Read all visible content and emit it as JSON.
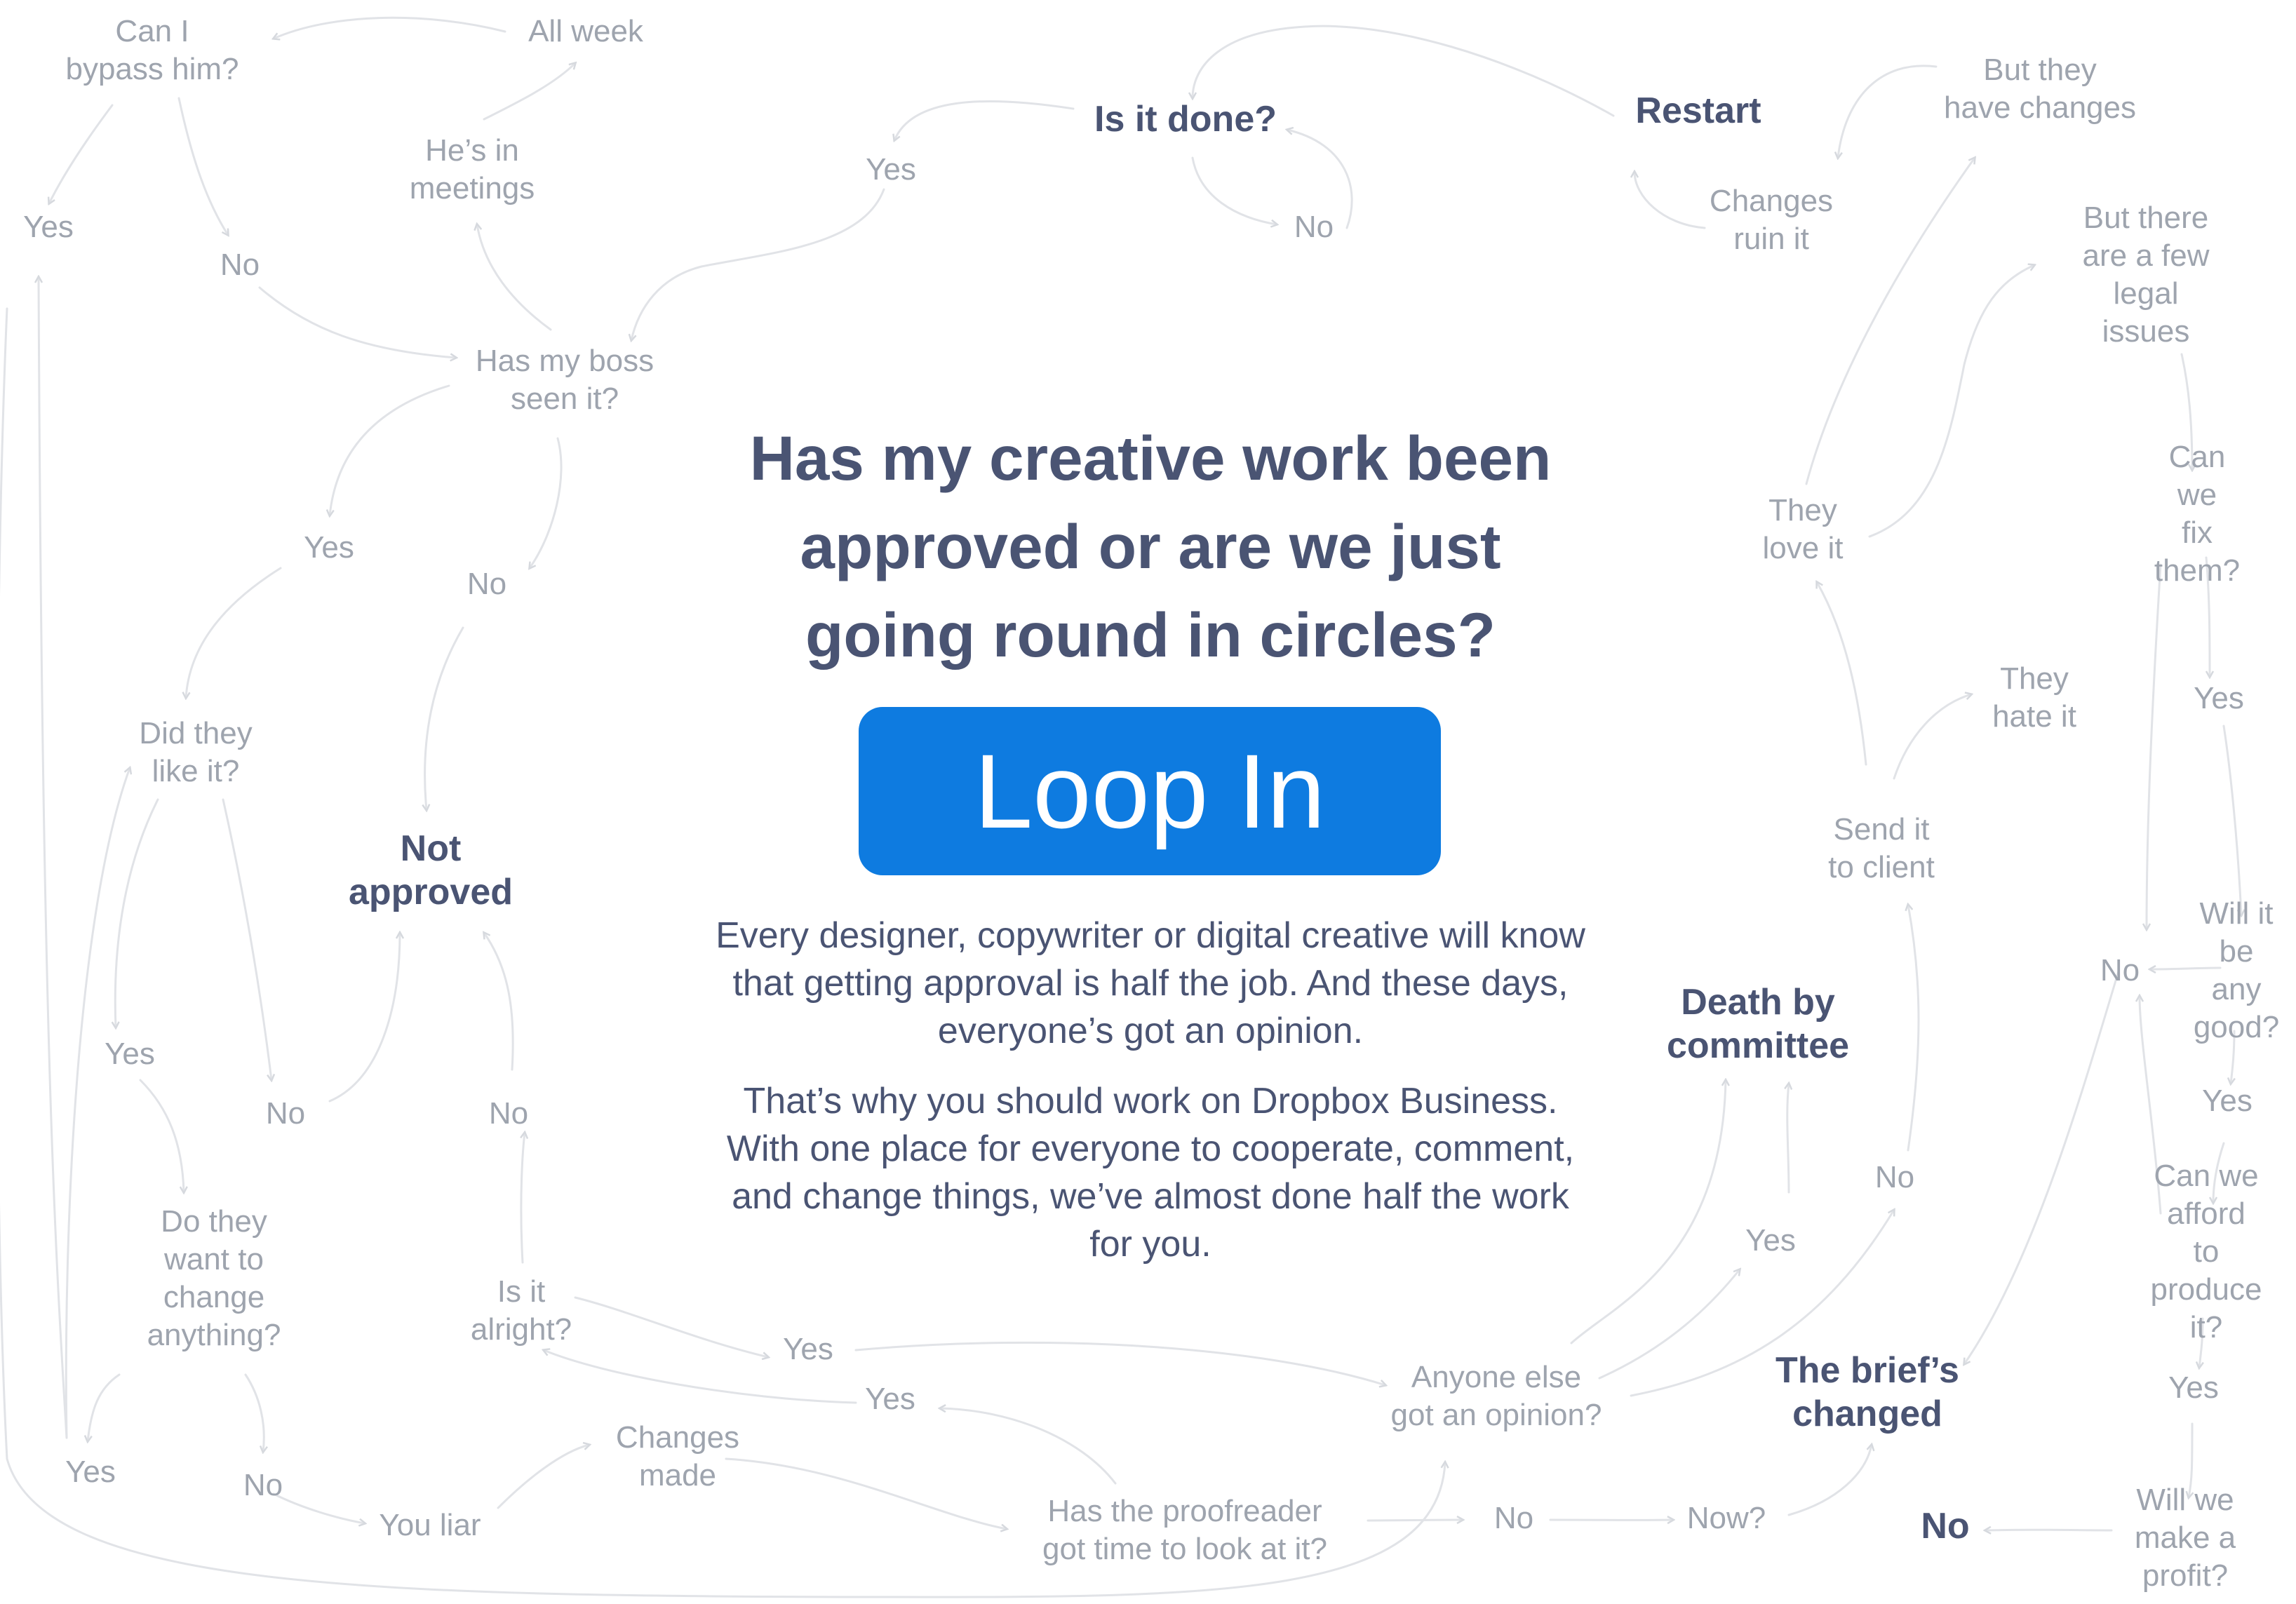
{
  "headline": "Has my creative work been approved or are we just going round in circles?",
  "cta_label": "Loop In",
  "body_paragraphs": [
    "Every designer, copywriter or digital creative will know that getting approval is half the job. And these days, everyone’s got an opinion.",
    "That’s why you should work on Dropbox Business. With one place for everyone to cooperate, comment, and change things, we’ve almost done half the work for you."
  ],
  "colors": {
    "background": "#ffffff",
    "cta_background": "#0e7be0",
    "cta_text": "#ffffff",
    "headline_text": "#4a5473",
    "node_text": "#9ea4ae",
    "connector": "#e1e3e7"
  },
  "nodes": {
    "can_i_bypass": "Can I\nbypass him?",
    "all_week": "All week",
    "hes_in_meetings": "He’s in\nmeetings",
    "yes_bypass": "Yes",
    "no_bypass": "No",
    "has_boss_seen": "Has my boss\nseen it?",
    "yes_boss_seen": "Yes",
    "no_boss_seen": "No",
    "did_they_like": "Did they\nlike it?",
    "not_approved": "Not\napproved",
    "yes_liked": "Yes",
    "no_liked": "No",
    "do_they_want_change": "Do they\nwant to\nchange\nanything?",
    "yes_change": "Yes",
    "no_change": "No",
    "you_liar": "You liar",
    "changes_made": "Changes\nmade",
    "is_it_alright": "Is it\nalright?",
    "no_alright": "No",
    "yes_alright": "Yes",
    "yes_proofreader": "Yes",
    "has_proofreader": "Has the proofreader\ngot time to look at it?",
    "no_proofreader": "No",
    "now": "Now?",
    "anyone_else": "Anyone else\ngot an opinion?",
    "yes_anyone": "Yes",
    "death_by_committee": "Death by\ncommittee",
    "no_anyone": "No",
    "send_to_client": "Send it\nto client",
    "they_love_it": "They\nlove it",
    "they_hate_it": "They\nhate it",
    "brief_changed": "The brief’s\nchanged",
    "yes_done": "Yes",
    "is_it_done": "Is it done?",
    "no_done": "No",
    "restart": "Restart",
    "changes_ruin_it": "Changes\nruin it",
    "but_they_have_changes": "But they\nhave changes",
    "but_legal_issues": "But there\nare a few\nlegal issues",
    "can_we_fix": "Can we\nfix them?",
    "yes_fix": "Yes",
    "will_it_be_good": "Will it\nbe any\ngood?",
    "no_right": "No",
    "yes_good": "Yes",
    "can_we_afford": "Can we\nafford to\nproduce it?",
    "yes_afford": "Yes",
    "will_we_profit": "Will we\nmake a profit?",
    "final_no": "No"
  }
}
